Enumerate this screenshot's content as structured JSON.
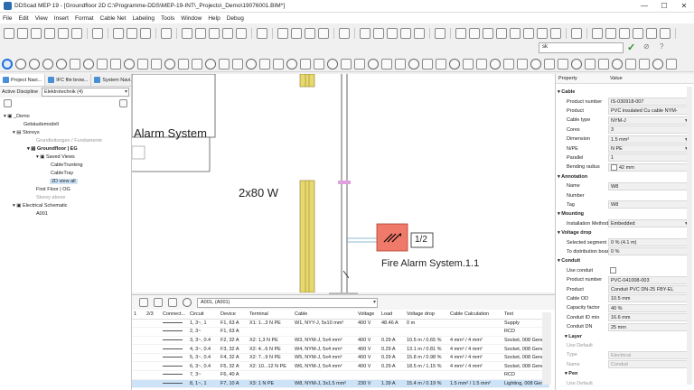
{
  "window": {
    "title": "DDScad MEP 19 - [Groundfloor 2D  C:\\Programme-DDS\\MEP-19-INT\\_Projects\\_Demo\\19076001.BIM*]",
    "minimize": "—",
    "maximize": "☐",
    "close": "✕"
  },
  "menu": [
    "File",
    "Edit",
    "View",
    "Insert",
    "Format",
    "Cable Net",
    "Labeling",
    "Tools",
    "Window",
    "Help",
    "Debug"
  ],
  "search": {
    "value": "sk"
  },
  "left_panel": {
    "tabs": [
      "Project Navi...",
      "IFC file brow...",
      "System Navi..."
    ],
    "discipline_label": "Active Discipline",
    "discipline_value": "Elektrotechnik (4)",
    "tree": [
      "_Demo",
      "Gebäudemodell",
      "Storeys",
      "Grundleitungen / Fundamente",
      "Groundfloor | EG",
      "Saved Views",
      "CableTrunking",
      "CableTray",
      "2D view all",
      "First Floor | OG",
      "Storey above",
      "Electrical Schematic",
      "A001"
    ]
  },
  "canvas": {
    "label_alarm": "Alarm System",
    "label_power": "2x80 W",
    "tag": "1/2",
    "label_fire": "Fire Alarm System.1.1"
  },
  "table": {
    "selector": "A001, (A001)",
    "columns": [
      "1",
      "2/3",
      "Connect...",
      "Circuit",
      "Device",
      "Terminal",
      "Cable",
      "Voltage",
      "Load",
      "Voltage drop",
      "Cable Calculation",
      "Text"
    ],
    "rows": [
      [
        "",
        "",
        "",
        "1, 3~, 1",
        "F1, 63 A",
        "X1: 1...3 N PE",
        "W1, NYY-J, 5x10 mm²",
        "400 V",
        "48.46 A",
        "0 m",
        "",
        "Supply"
      ],
      [
        "",
        "",
        "",
        "2, 3~",
        "F1, 63 A",
        "",
        "",
        "",
        "",
        "",
        "",
        "RCD"
      ],
      [
        "",
        "",
        "",
        "3, 3~, 0.4",
        "F2, 32 A",
        "X2: 1,3 N PE",
        "W3, NYM-J, 5x4 mm²",
        "400 V",
        "0.29 A",
        "10.5 m / 0.65 %",
        "4 mm² / 4 mm²",
        "Socket, 008 Gene"
      ],
      [
        "",
        "",
        "",
        "4, 3~, 0.4",
        "F3, 32 A",
        "X2: 4...6 N PE",
        "W4, NYM-J, 5x4 mm²",
        "400 V",
        "0.29 A",
        "13.1 m / 0.81 %",
        "4 mm² / 4 mm²",
        "Socket, 008 Gene"
      ],
      [
        "",
        "",
        "",
        "5, 3~, 0.4",
        "F4, 32 A",
        "X2: 7...9 N PE",
        "W5, NYM-J, 5x4 mm²",
        "400 V",
        "0.29 A",
        "15.8 m / 0.98 %",
        "4 mm² / 4 mm²",
        "Socket, 008 Gene"
      ],
      [
        "",
        "",
        "",
        "6, 3~, 0.4",
        "F5, 32 A",
        "X2: 10...12 N PE",
        "W6, NYM-J, 5x4 mm²",
        "400 V",
        "0.29 A",
        "18.5 m / 1.15 %",
        "4 mm² / 4 mm²",
        "Socket, 008 Gene"
      ],
      [
        "",
        "",
        "",
        "7, 3~",
        "F6, 40 A",
        "",
        "",
        "",
        "",
        "",
        "",
        "RCD"
      ],
      [
        "",
        "",
        "",
        "8, 1~, 1",
        "F7, 10 A",
        "X3: 1 N PE",
        "W8, NYM-J, 3x1.5 mm²",
        "230 V",
        "1.39 A",
        "15.4 m / 0.19 %",
        "1.5 mm² / 1.5 mm²",
        "Lighting, 008 Gen"
      ]
    ]
  },
  "properties": {
    "header": [
      "Property",
      "Value"
    ],
    "rows": [
      {
        "type": "section",
        "k": "Cable"
      },
      {
        "k": "Product number",
        "v": "IS-030918-007"
      },
      {
        "k": "Product",
        "v": "PVC insulated Cu cable NYM-"
      },
      {
        "k": "Cable type",
        "v": "NYM-J",
        "dd": true
      },
      {
        "k": "Cores",
        "v": "3"
      },
      {
        "k": "Dimension",
        "v": "1.5 mm²",
        "dd": true
      },
      {
        "k": "N/PE",
        "v": "N PE",
        "dd": true
      },
      {
        "k": "Parallel",
        "v": "1"
      },
      {
        "k": "Bending radius",
        "v": "42 mm",
        "chk": true
      },
      {
        "type": "section",
        "k": "Annotation"
      },
      {
        "k": "Name",
        "v": "W8"
      },
      {
        "k": "Number",
        "v": ""
      },
      {
        "k": "Tag",
        "v": "W8"
      },
      {
        "type": "section",
        "k": "Mounting"
      },
      {
        "k": "Installation Method",
        "v": "Embedded",
        "dd": true
      },
      {
        "type": "section",
        "k": "Voltage drop"
      },
      {
        "k": "Selected segment",
        "v": "0 % (4.1 m)"
      },
      {
        "k": "To distribution board",
        "v": "0 %"
      },
      {
        "type": "section",
        "k": "Conduit"
      },
      {
        "k": "Use conduit",
        "v": "",
        "chk": true
      },
      {
        "k": "Product number",
        "v": "PVC-041008-003"
      },
      {
        "k": "Product",
        "v": "Conduit PVC DN-25 FBY-EL"
      },
      {
        "k": "Cable OD",
        "v": "10.5 mm"
      },
      {
        "k": "Capacity factor",
        "v": "40 %"
      },
      {
        "k": "Conduit ID min",
        "v": "16.6 mm"
      },
      {
        "k": "Conduit DN",
        "v": "25 mm"
      },
      {
        "type": "sub",
        "k": "Layer"
      },
      {
        "k": "Use Default",
        "v": "",
        "gray": true
      },
      {
        "k": "Type",
        "v": "Electrical",
        "gray": true
      },
      {
        "k": "Name",
        "v": "Conduit",
        "gray": true
      },
      {
        "type": "sub",
        "k": "Pen"
      },
      {
        "k": "Use Default",
        "v": "",
        "gray": true
      }
    ]
  }
}
